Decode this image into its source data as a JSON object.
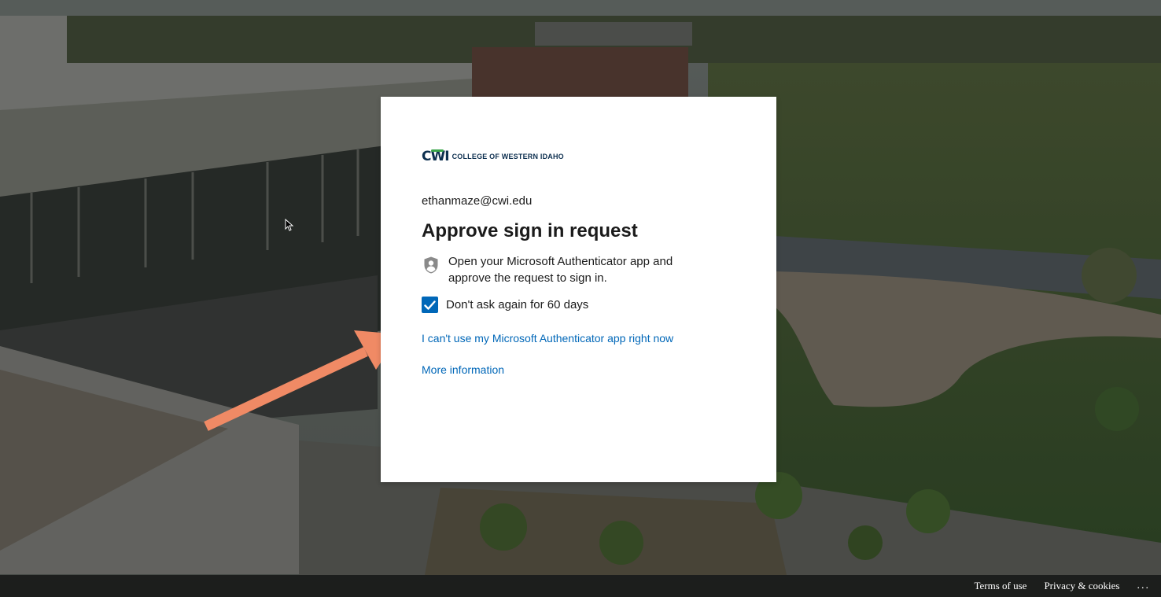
{
  "logo": {
    "mark_prefix": "C",
    "mark_w": "W",
    "mark_suffix": "I",
    "text": "COLLEGE OF WESTERN IDAHO",
    "colors": {
      "navy": "#0d2f4f",
      "green": "#3aa54a"
    }
  },
  "signin": {
    "email": "ethanmaze@cwi.edu",
    "title": "Approve sign in request",
    "instruction": "Open your Microsoft Authenticator app and approve the request to sign in.",
    "instruction_icon": "authenticator-lock-icon",
    "checkbox_label": "Don't ask again for 60 days",
    "checkbox_checked": true,
    "cant_use_link": "I can't use my Microsoft Authenticator app right now",
    "more_info_link": "More information"
  },
  "footer": {
    "terms": "Terms of use",
    "privacy": "Privacy & cookies",
    "more": "..."
  },
  "colors": {
    "accent": "#0067b8",
    "annotation_arrow": "#f08a65"
  }
}
